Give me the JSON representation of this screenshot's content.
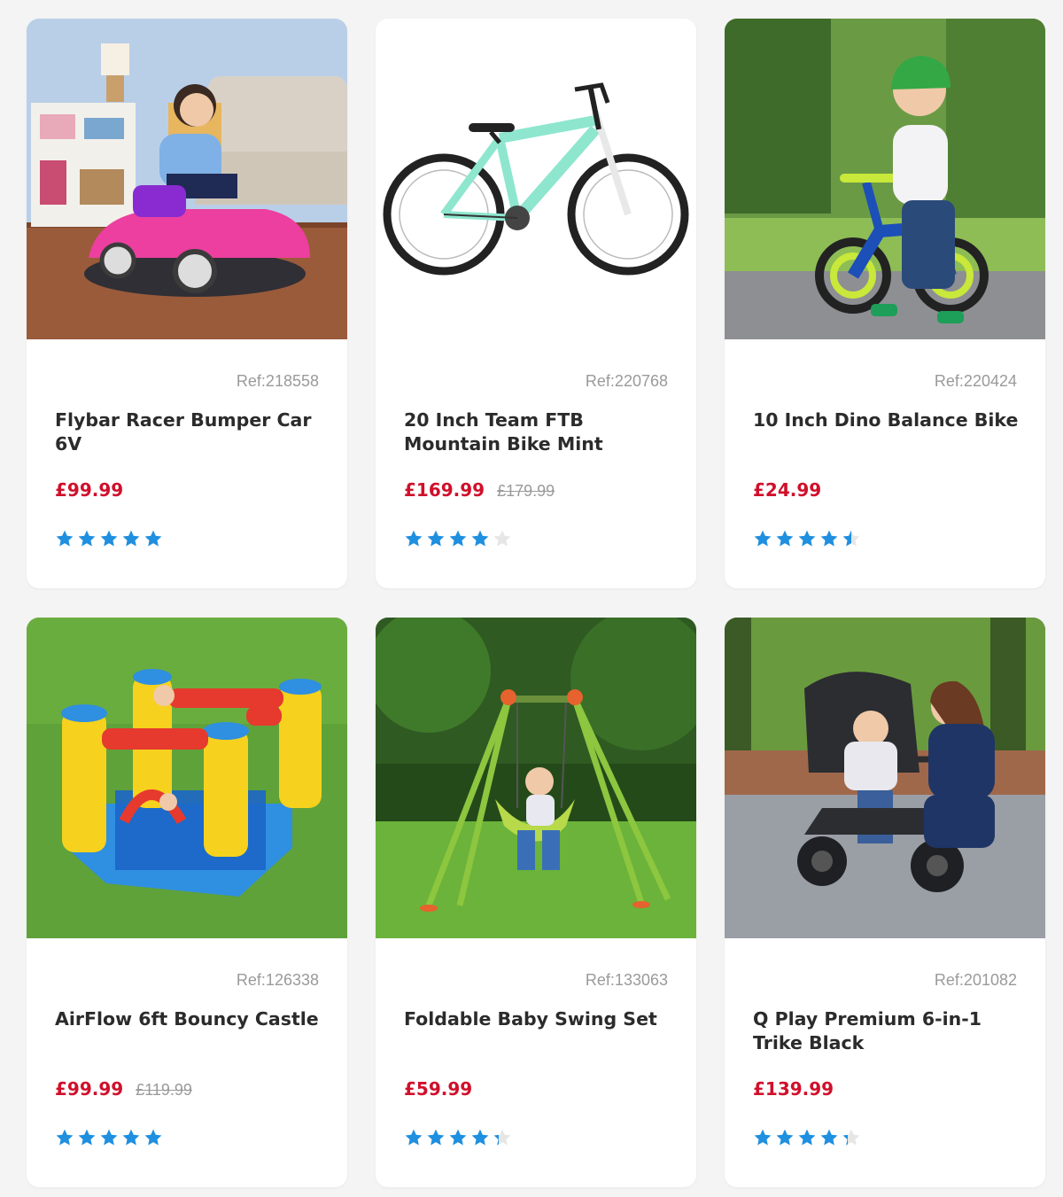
{
  "colors": {
    "price": "#d0102b",
    "star": "#1f8fe0",
    "star_empty": "#e6e6e6",
    "ref": "#9a9a9a",
    "title": "#2b2b2b"
  },
  "products": [
    {
      "ref": "Ref:218558",
      "title": "Flybar Racer Bumper Car 6V",
      "price": "£99.99",
      "was": "",
      "rating": 5,
      "image": "bumper-car-photo"
    },
    {
      "ref": "Ref:220768",
      "title": "20 Inch Team FTB Mountain Bike Mint",
      "price": "£169.99",
      "was": "£179.99",
      "rating": 4,
      "image": "mountain-bike-photo"
    },
    {
      "ref": "Ref:220424",
      "title": "10 Inch Dino Balance Bike",
      "price": "£24.99",
      "was": "",
      "rating": 4.5,
      "image": "balance-bike-photo"
    },
    {
      "ref": "Ref:126338",
      "title": "AirFlow 6ft Bouncy Castle",
      "price": "£99.99",
      "was": "£119.99",
      "rating": 5,
      "image": "bouncy-castle-photo"
    },
    {
      "ref": "Ref:133063",
      "title": "Foldable Baby Swing Set",
      "price": "£59.99",
      "was": "",
      "rating": 4.3,
      "image": "swing-set-photo"
    },
    {
      "ref": "Ref:201082",
      "title": "Q Play Premium 6-in-1 Trike Black",
      "price": "£139.99",
      "was": "",
      "rating": 4.3,
      "image": "trike-photo"
    }
  ]
}
